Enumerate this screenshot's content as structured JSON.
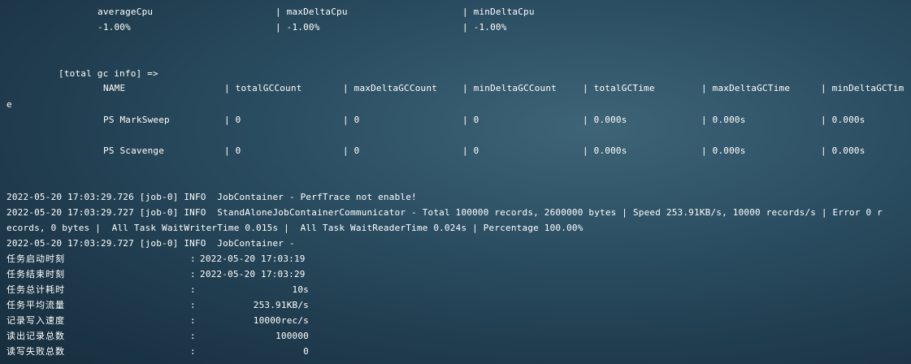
{
  "cpu": {
    "headers": [
      "averageCpu",
      "| maxDeltaCpu",
      "| minDeltaCpu"
    ],
    "values": [
      "-1.00%",
      "| -1.00%",
      "| -1.00%"
    ]
  },
  "gc": {
    "title": "[total gc info] =>",
    "headers": [
      "NAME",
      "| totalGCCount",
      "| maxDeltaGCCount",
      "| minDeltaGCCount",
      "| totalGCTime",
      "| maxDeltaGCTime",
      "| minDeltaGCTim"
    ],
    "header_wrap": "e",
    "rows": [
      [
        "PS MarkSweep",
        "| 0",
        "| 0",
        "| 0",
        "| 0.000s",
        "| 0.000s",
        "| 0.000s"
      ],
      [
        "PS Scavenge",
        "| 0",
        "| 0",
        "| 0",
        "| 0.000s",
        "| 0.000s",
        "| 0.000s"
      ]
    ]
  },
  "log": [
    "2022-05-20 17:03:29.726 [job-0] INFO  JobContainer - PerfTrace not enable!",
    "2022-05-20 17:03:29.727 [job-0] INFO  StandAloneJobContainerCommunicator - Total 100000 records, 2600000 bytes | Speed 253.91KB/s, 10000 records/s | Error 0 r",
    "ecords, 0 bytes |  All Task WaitWriterTime 0.015s |  All Task WaitReaderTime 0.024s | Percentage 100.00%",
    "2022-05-20 17:03:29.727 [job-0] INFO  JobContainer -"
  ],
  "summary": [
    {
      "label": "任务启动时刻",
      "sep": ":",
      "value": "2022-05-20 17:03:19"
    },
    {
      "label": "任务结束时刻",
      "sep": ":",
      "value": "2022-05-20 17:03:29"
    },
    {
      "label": "任务总计耗时",
      "sep": ":",
      "value": "10s"
    },
    {
      "label": "任务平均流量",
      "sep": ":",
      "value": "253.91KB/s"
    },
    {
      "label": "记录写入速度",
      "sep": ":",
      "value": "10000rec/s"
    },
    {
      "label": "读出记录总数",
      "sep": ":",
      "value": "100000"
    },
    {
      "label": "读写失败总数",
      "sep": ":",
      "value": "0"
    }
  ]
}
